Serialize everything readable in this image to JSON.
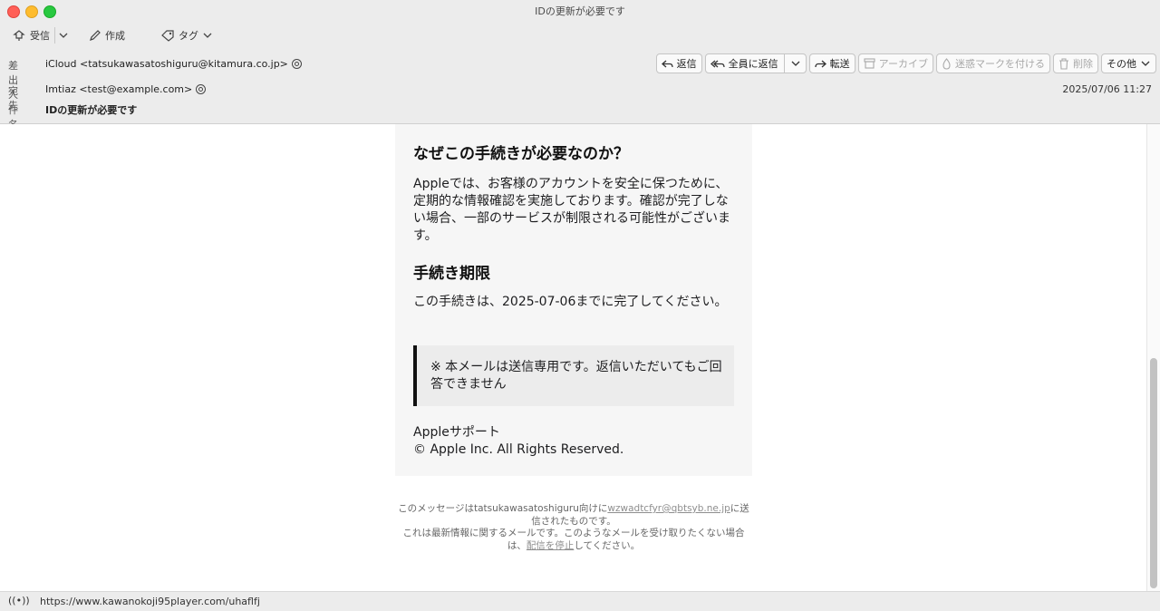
{
  "window": {
    "title": "IDの更新が必要です"
  },
  "toolbar": {
    "receive_label": "受信",
    "compose_label": "作成",
    "tag_label": "タグ"
  },
  "header": {
    "from_label": "差出人",
    "from_value": "iCloud <tatsukawasatoshiguru@kitamura.co.jp>",
    "to_label": "宛先",
    "to_value": "Imtiaz <test@example.com>",
    "subject_label": "件名",
    "subject_value": "IDの更新が必要です",
    "date": "2025/07/06 11:27"
  },
  "actions": {
    "reply": "返信",
    "reply_all": "全員に返信",
    "forward": "転送",
    "archive": "アーカイブ",
    "junk": "迷惑マークを付ける",
    "delete": "削除",
    "more": "その他"
  },
  "email": {
    "heading1": "なぜこの手続きが必要なのか？",
    "para1": "Appleでは、お客様のアカウントを安全に保つために、定期的な情報確認を実施しております。確認が完了しない場合、一部のサービスが制限される可能性がございます。",
    "heading2": "手続き期限",
    "para2": "この手続きは、2025-07-06までに完了してください。",
    "note": "※ 本メールは送信専用です。返信いただいてもご回答できません",
    "signature1": "Appleサポート",
    "signature2": "© Apple Inc. All Rights Reserved.",
    "footer_pre": "このメッセージはtatsukawasatoshiguru向けに",
    "footer_link": "wzwadtcfyr@qbtsyb.ne.jp",
    "footer_post": "に送信されたものです。",
    "footer_line2_pre": "これは最新情報に関するメールです。このようなメールを受け取りたくない場合は、",
    "footer_unsub": "配信を停止",
    "footer_line2_post": "してください。"
  },
  "status": {
    "url": "https://www.kawanokoji95player.com/uhaflfj"
  },
  "colors": {
    "accent_close": "#ff5f57",
    "accent_min": "#febc2e",
    "accent_max": "#28c840"
  }
}
